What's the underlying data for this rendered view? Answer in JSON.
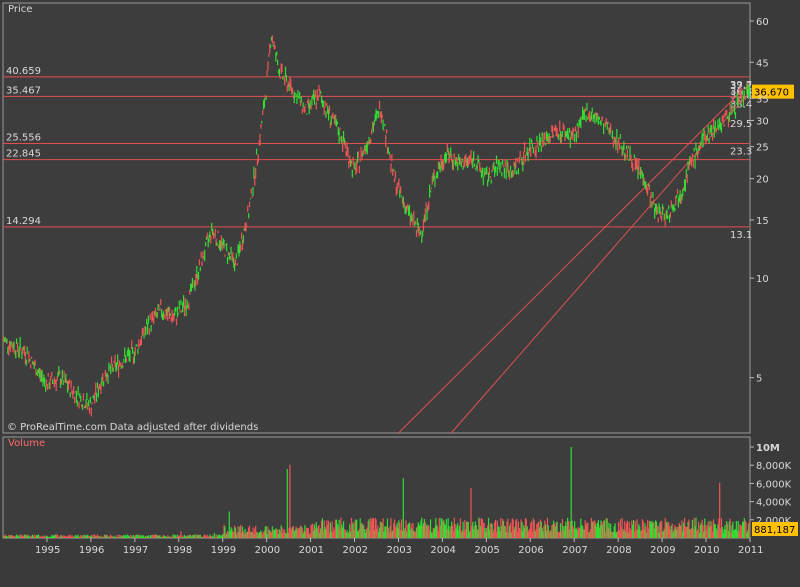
{
  "chart_data": {
    "type": "line",
    "title": "Price",
    "volume_title": "Volume",
    "footer": "© ProRealTime.com  Data adjusted after dividends",
    "y_scale": "log",
    "ylim": [
      3.4,
      68
    ],
    "x_range": [
      1994.0,
      2011.0
    ],
    "y_tick_labels": [
      "60",
      "45",
      "35",
      "30",
      "25",
      "20",
      "15",
      "10",
      "5"
    ],
    "y_tick_values": [
      60,
      45,
      35,
      30,
      25,
      20,
      15,
      10,
      5
    ],
    "x_tick_labels": [
      "1995",
      "1996",
      "1997",
      "1998",
      "1999",
      "2000",
      "2001",
      "2002",
      "2003",
      "2004",
      "2005",
      "2006",
      "2007",
      "2008",
      "2009",
      "2010",
      "2011"
    ],
    "x_tick_values": [
      1995,
      1996,
      1997,
      1998,
      1999,
      2000,
      2001,
      2002,
      2003,
      2004,
      2005,
      2006,
      2007,
      2008,
      2009,
      2010,
      2011
    ],
    "last_price_label": "36.670",
    "horizontal_levels": [
      {
        "value": 40.659,
        "left_label": "40.659",
        "right_label": "39.7"
      },
      {
        "value": 35.467,
        "left_label": "35.467",
        "right_label": "33.4"
      },
      {
        "value": 25.556,
        "left_label": "25.556",
        "right_label": "23.3"
      },
      {
        "value": 22.845,
        "left_label": "22.845",
        "right_label": ""
      },
      {
        "value": 14.294,
        "left_label": "14.294",
        "right_label": "13.1"
      }
    ],
    "extra_right_labels": [
      {
        "value": 29.5,
        "label": "29.5"
      },
      {
        "value": 38.4,
        "label": "37.2"
      },
      {
        "value": 36.9,
        "label": "36.8"
      },
      {
        "value": 35.9,
        "label": "35.8"
      }
    ],
    "trendlines": [
      {
        "from": {
          "x": 2003.0,
          "y": 2.6
        },
        "to": {
          "x": 2010.85,
          "y": 37.3
        }
      },
      {
        "from": {
          "x": 2004.2,
          "y": 2.6
        },
        "to": {
          "x": 2010.95,
          "y": 36.0
        }
      }
    ],
    "price_series": {
      "name": "Price",
      "x": [
        1994.0,
        1994.5,
        1994.8,
        1995.0,
        1995.3,
        1995.7,
        1996.0,
        1996.3,
        1996.7,
        1997.0,
        1997.3,
        1997.6,
        1997.9,
        1998.2,
        1998.5,
        1998.75,
        1999.0,
        1999.3,
        1999.6,
        1999.8,
        2000.0,
        2000.1,
        2000.3,
        2000.6,
        2000.9,
        2001.2,
        2001.5,
        2001.7,
        2002.0,
        2002.3,
        2002.6,
        2002.9,
        2003.2,
        2003.5,
        2003.8,
        2004.1,
        2004.4,
        2004.7,
        2005.0,
        2005.3,
        2005.6,
        2006.0,
        2006.3,
        2006.6,
        2007.0,
        2007.3,
        2007.7,
        2008.0,
        2008.3,
        2008.6,
        2008.85,
        2009.1,
        2009.4,
        2009.7,
        2010.0,
        2010.4,
        2010.8,
        2011.0
      ],
      "y": [
        6.5,
        6.0,
        5.2,
        4.8,
        5.0,
        4.4,
        4.1,
        5.1,
        5.6,
        6.0,
        7.2,
        8.0,
        7.6,
        8.5,
        11.0,
        14.0,
        12.5,
        11.0,
        16.0,
        24.0,
        38.0,
        55.0,
        42.0,
        37.0,
        32.0,
        36.0,
        30.0,
        27.0,
        21.0,
        26.0,
        33.0,
        20.0,
        16.0,
        13.5,
        20.0,
        24.0,
        22.0,
        23.0,
        20.0,
        22.0,
        21.0,
        25.0,
        26.0,
        28.0,
        27.0,
        32.0,
        29.0,
        26.0,
        23.0,
        20.0,
        16.0,
        15.5,
        18.0,
        23.0,
        27.0,
        30.0,
        35.0,
        36.67
      ]
    },
    "volume": {
      "labels": [
        "10M",
        "8,000K",
        "6,000K",
        "4,000K",
        "2,000K"
      ],
      "label_values": [
        10000,
        8000,
        6000,
        4000,
        2000
      ],
      "last_label": "881,187",
      "max_k": 10000
    }
  }
}
